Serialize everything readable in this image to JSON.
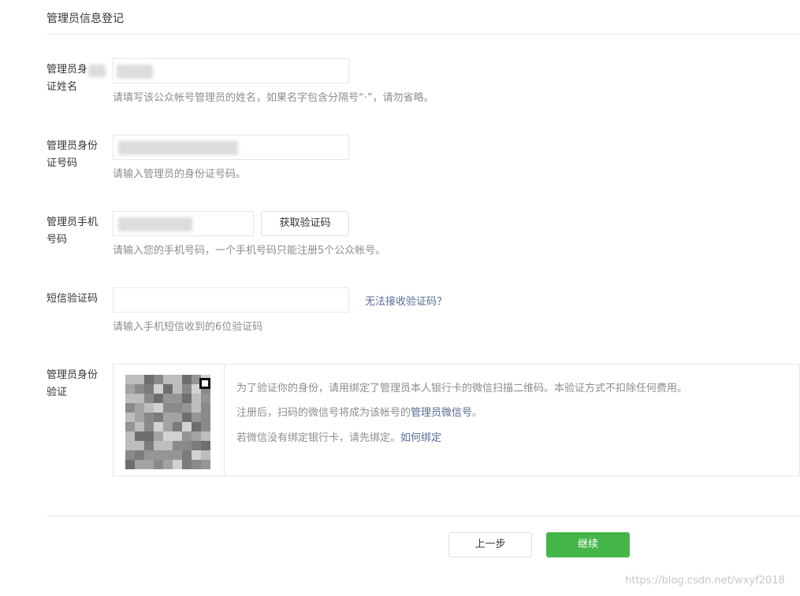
{
  "page": {
    "section_title": "管理员信息登记"
  },
  "form": {
    "name": {
      "label_line1": "管理员身",
      "label_line2": "证姓名",
      "value": "",
      "tip": "请填写该公众帐号管理员的姓名，如果名字包含分隔号“·”，请勿省略。"
    },
    "id_number": {
      "label_line1": "管理员身份",
      "label_line2": "证号码",
      "value": "",
      "tip": "请输入管理员的身份证号码。"
    },
    "phone": {
      "label_line1": "管理员手机",
      "label_line2": "号码",
      "value": "",
      "get_code_label": "获取验证码",
      "tip": "请输入您的手机号码，一个手机号码只能注册5个公众帐号。"
    },
    "sms_code": {
      "label": "短信验证码",
      "value": "",
      "cannot_receive_link": "无法接收验证码？",
      "tip": "请输入手机短信收到的6位验证码"
    },
    "identity_verify": {
      "label_line1": "管理员身份",
      "label_line2": "验证",
      "line1": "为了验证你的身份，请用绑定了管理员本人银行卡的微信扫描二维码。本验证方式不扣除任何费用。",
      "line2_prefix": "注册后，扫码的微信号将成为该帐号的",
      "line2_highlight": "管理员微信号",
      "line2_suffix": "。",
      "line3_prefix": "若微信没有绑定银行卡，请先绑定。",
      "line3_link": "如何绑定",
      "qr_icon": "qr-code-icon"
    }
  },
  "footer": {
    "prev_label": "上一步",
    "next_label": "继续",
    "watermark": "https://blog.csdn.net/wxyf2018"
  },
  "colors": {
    "accent_green": "#44b549",
    "link_blue": "#576b95",
    "tip_gray": "#8d8d8d",
    "border": "#e7e7eb"
  }
}
